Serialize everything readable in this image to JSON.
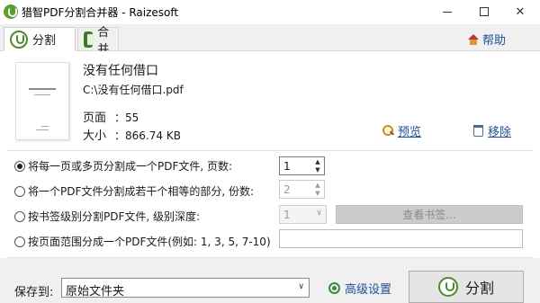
{
  "window": {
    "title": "猎智PDF分割合并器 - Raizesoft",
    "minimize": "",
    "maximize": "",
    "close": "✕"
  },
  "tabs": [
    {
      "label": "分割",
      "active": true
    },
    {
      "label": "合并",
      "active": false
    }
  ],
  "help_label": "帮助",
  "document": {
    "name": "没有任何借口",
    "path": "C:\\没有任何借口.pdf",
    "pages_label": "页面",
    "pages_value": "55",
    "size_label": "大小",
    "size_value": "866.74 KB",
    "separator": "："
  },
  "actions": {
    "preview_label": "预览",
    "remove_label": "移除"
  },
  "options": {
    "selected_index": 0,
    "opt1_label": "将每一页或多页分割成一个PDF文件, 页数:",
    "opt1_value": "1",
    "opt2_label": "将一个PDF文件分割成若干个相等的部分, 份数:",
    "opt2_value": "2",
    "opt3_label": "按书签级别分割PDF文件, 级别深度:",
    "opt3_value": "1",
    "opt3_button": "查看书签...",
    "opt4_label": "按页面范围分成一个PDF文件(例如: 1, 3, 5, 7-10)",
    "opt4_value": ""
  },
  "footer": {
    "save_label": "保存到:",
    "save_value": "原始文件夹",
    "advanced_label": "高级设置",
    "split_label": "分割"
  },
  "icons": {
    "arrow_up": "▲",
    "arrow_down": "▼",
    "chevron": "∨"
  },
  "colors": {
    "link": "#1f4f96",
    "brand_green": "#4b8d2a"
  }
}
